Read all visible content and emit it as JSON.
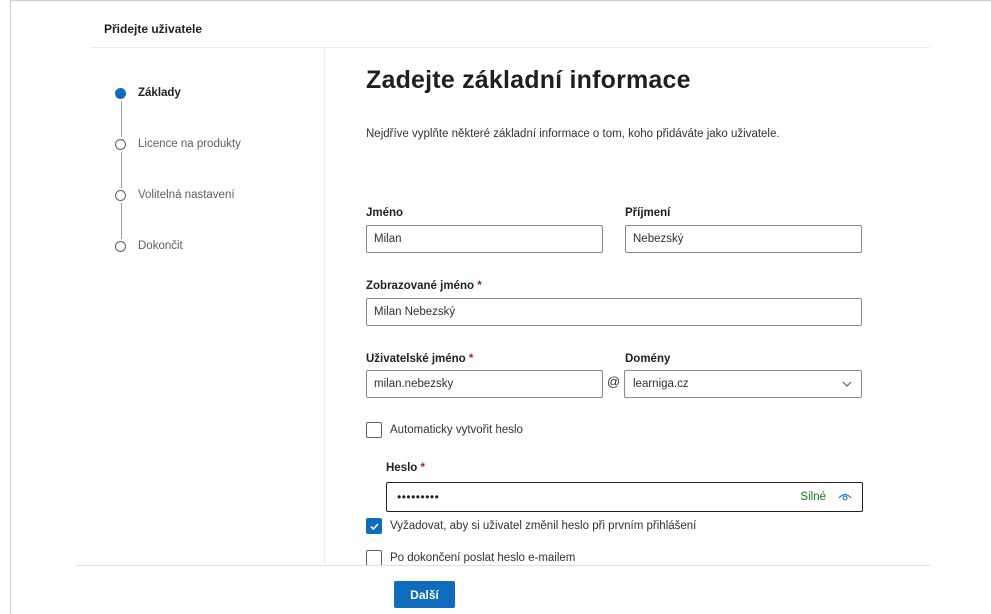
{
  "panel": {
    "title": "Přidejte uživatele"
  },
  "steps": [
    {
      "label": "Základy",
      "active": true
    },
    {
      "label": "Licence na produkty",
      "active": false
    },
    {
      "label": "Volitelná nastavení",
      "active": false
    },
    {
      "label": "Dokončit",
      "active": false
    }
  ],
  "main": {
    "title": "Zadejte základní informace",
    "description": "Nejdříve vyplňte některé základní informace o tom, koho přidáváte jako uživatele."
  },
  "form": {
    "first_name": {
      "label": "Jméno",
      "value": "Milan"
    },
    "last_name": {
      "label": "Příjmení",
      "value": "Nebezský"
    },
    "display_name": {
      "label": "Zobrazované jméno",
      "required_mark": "*",
      "value": "Milan Nebezský"
    },
    "username": {
      "label": "Uživatelské jméno",
      "required_mark": "*",
      "value": "milan.nebezsky",
      "at_symbol": "@"
    },
    "domain": {
      "label": "Domény",
      "value": "learniga.cz"
    },
    "auto_password": {
      "label": "Automaticky vytvořit heslo",
      "checked": false
    },
    "password": {
      "label": "Heslo",
      "required_mark": "*",
      "masked_value": "•••••••••",
      "strength": "Silné"
    },
    "require_change": {
      "label": "Vyžadovat, aby si uživatel změnil heslo při prvním přihlášení",
      "checked": true
    },
    "email_password": {
      "label": "Po dokončení poslat heslo e-mailem",
      "checked": false
    }
  },
  "footer": {
    "next_label": "Další"
  },
  "colors": {
    "accent": "#0f6cbd",
    "strength_good": "#107c10",
    "required": "#a4262c"
  },
  "icons": {
    "check": "check-icon",
    "chevron": "chevron-down-icon",
    "eye": "eye-icon"
  }
}
